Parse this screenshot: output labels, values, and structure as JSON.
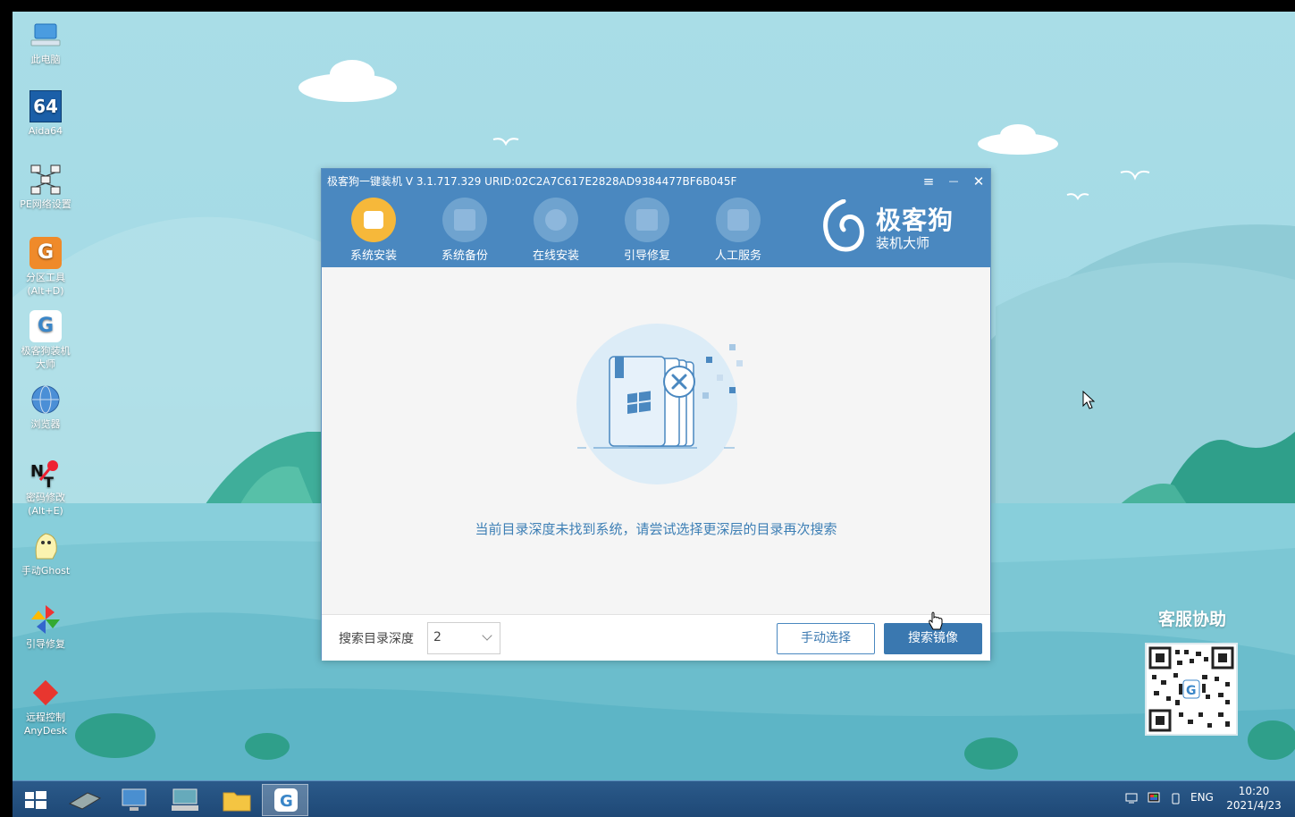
{
  "desktop": {
    "icons": [
      {
        "name": "this-pc",
        "label": "此电脑"
      },
      {
        "name": "aida64",
        "label": "Aida64",
        "glyph": "64"
      },
      {
        "name": "pe-network",
        "label": "PE网络设置"
      },
      {
        "name": "partition-tool",
        "label": "分区工具\n(Alt+D)"
      },
      {
        "name": "jikegou-installer",
        "label": "极客狗装机\n大师"
      },
      {
        "name": "browser",
        "label": "浏览器"
      },
      {
        "name": "password-modify",
        "label": "密码修改\n(Alt+E)"
      },
      {
        "name": "manual-ghost",
        "label": "手动Ghost"
      },
      {
        "name": "boot-repair",
        "label": "引导修复"
      },
      {
        "name": "remote-control",
        "label": "远程控制\nAnyDesk"
      }
    ]
  },
  "window": {
    "title": "极客狗一键装机 V 3.1.717.329 URID:02C2A7C617E2828AD9384477BF6B045F",
    "controls": {
      "menu": "≡",
      "minimize": "—",
      "close": "✕"
    },
    "nav": [
      {
        "label": "系统安装",
        "active": true
      },
      {
        "label": "系统备份",
        "active": false
      },
      {
        "label": "在线安装",
        "active": false
      },
      {
        "label": "引导修复",
        "active": false
      },
      {
        "label": "人工服务",
        "active": false
      }
    ],
    "brand": {
      "name": "极客狗",
      "subtitle": "装机大师"
    },
    "message": "当前目录深度未找到系统，请尝试选择更深层的目录再次搜索",
    "footer": {
      "depth_label": "搜索目录深度",
      "depth_value": "2",
      "manual_button": "手动选择",
      "search_button": "搜索镜像"
    }
  },
  "qr": {
    "title": "客服协助"
  },
  "taskbar": {
    "language": "ENG",
    "time": "10:20",
    "date": "2021/4/23"
  },
  "colors": {
    "accent": "#4a88c0",
    "active_nav": "#f6b83a",
    "message_text": "#3d7fb5"
  }
}
